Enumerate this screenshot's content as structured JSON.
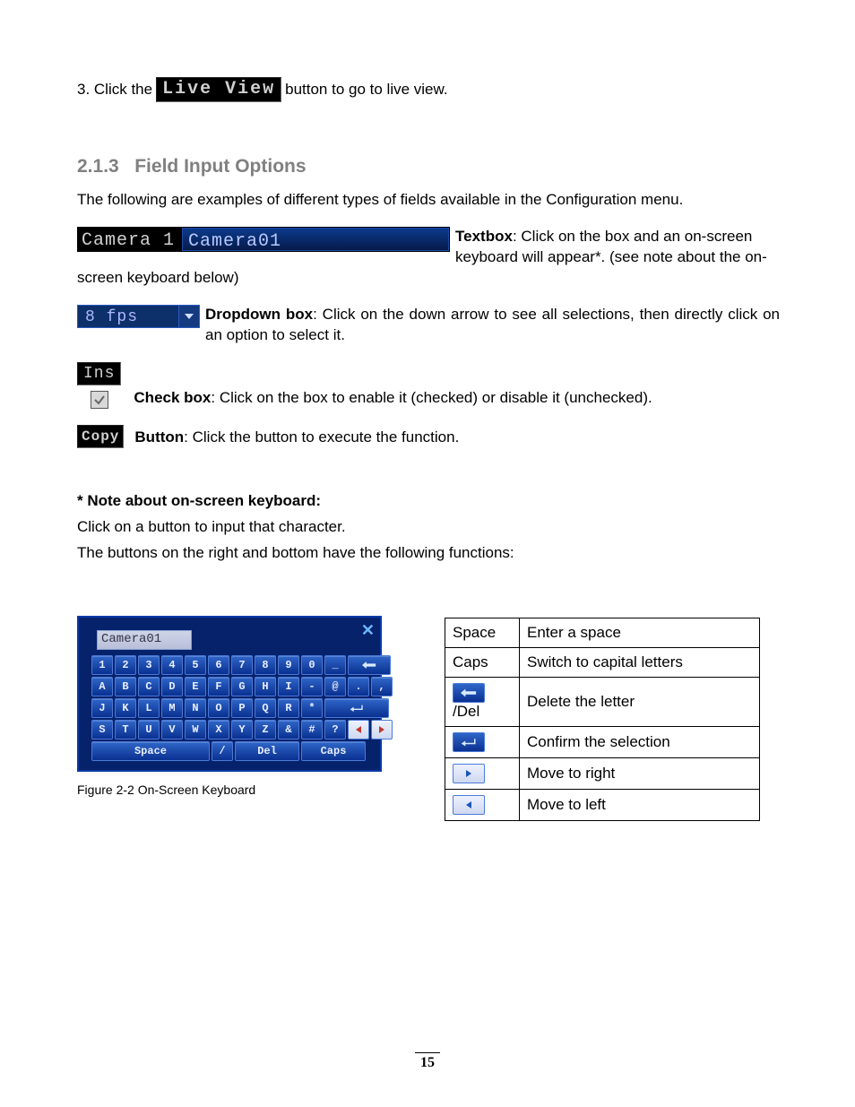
{
  "step3": {
    "pre": "3. Click the ",
    "button": "Live View",
    "post": " button to go to live view."
  },
  "section": {
    "num": "2.1.3",
    "title": "Field Input Options"
  },
  "intro": "The following are examples of different types of fields available in the Configuration menu.",
  "textbox": {
    "label": "Camera 1",
    "value": "Camera01",
    "name": "Textbox",
    "desc": ": Click on the box and an on-screen keyboard will appear*. (see note about the on-screen keyboard below)"
  },
  "dropdown": {
    "value": "8   fps",
    "name": "Dropdown box",
    "desc": ": Click on the down arrow to see all selections, then directly click on an option to select it."
  },
  "checkbox": {
    "label": "Ins",
    "name": "Check box",
    "desc": ": Click on the box to enable it (checked) or disable it (unchecked)."
  },
  "button_item": {
    "label": "Copy",
    "name": "Button",
    "desc": ": Click the button to execute the function."
  },
  "note": {
    "head": "* Note about on-screen keyboard:",
    "l1": "Click on a button to input that character.",
    "l2": "The buttons on the right and bottom have the following functions:"
  },
  "osk": {
    "field": "Camera01",
    "rows": [
      [
        "1",
        "2",
        "3",
        "4",
        "5",
        "6",
        "7",
        "8",
        "9",
        "0",
        "_"
      ],
      [
        "A",
        "B",
        "C",
        "D",
        "E",
        "F",
        "G",
        "H",
        "I",
        "-",
        "@",
        ".",
        ","
      ],
      [
        "J",
        "K",
        "L",
        "M",
        "N",
        "O",
        "P",
        "Q",
        "R",
        "*"
      ],
      [
        "S",
        "T",
        "U",
        "V",
        "W",
        "X",
        "Y",
        "Z",
        "&",
        "#",
        "?"
      ]
    ],
    "space": "Space",
    "slash": "/",
    "del": "Del",
    "caps": "Caps"
  },
  "fig_caption": "Figure 2-2 On-Screen Keyboard",
  "fn_table": [
    {
      "key": "Space",
      "desc": "Enter a space"
    },
    {
      "key": "Caps",
      "desc": "Switch to capital letters"
    },
    {
      "key": "/Del",
      "icon": "back",
      "desc": "Delete the letter"
    },
    {
      "key": "",
      "icon": "enter",
      "desc": "Confirm the selection"
    },
    {
      "key": "",
      "icon": "right",
      "desc": "Move to right"
    },
    {
      "key": "",
      "icon": "left",
      "desc": "Move to left"
    }
  ],
  "page_number": "15"
}
